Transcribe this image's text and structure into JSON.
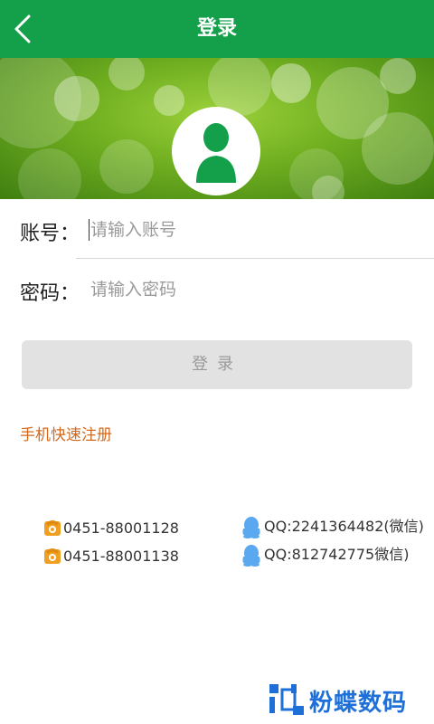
{
  "header": {
    "title": "登录",
    "back_icon": "chevron-left-icon",
    "color": "#14a04a"
  },
  "banner": {
    "avatar_icon": "user-avatar-icon",
    "accent": "#14a04a"
  },
  "form": {
    "account_label": "账号：",
    "account_placeholder": "请输入账号",
    "password_label": "密码：",
    "password_placeholder": "请输入密码",
    "login_button": "登录"
  },
  "register_link": "手机快速注册",
  "contacts": [
    {
      "icon": "phone-icon",
      "text": "0451-88001128"
    },
    {
      "icon": "phone-icon",
      "text": "0451-88001138"
    },
    {
      "icon": "qq-icon",
      "text": "QQ:2241364482(微信)"
    },
    {
      "icon": "qq-icon",
      "text": "QQ:812742775微信)"
    }
  ],
  "watermark": {
    "text": "粉蝶数码",
    "icon": "logo-icon",
    "color": "#1f6fd8"
  }
}
